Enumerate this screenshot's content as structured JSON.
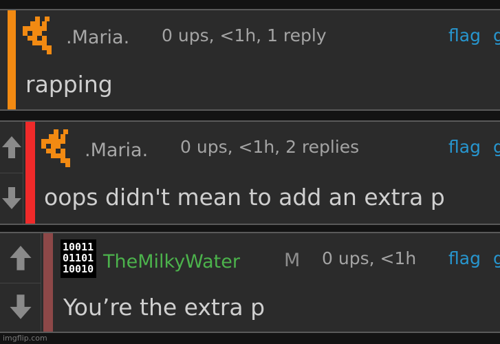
{
  "colors": {
    "stripe_orange": "#f28a12",
    "stripe_red": "#f02a2a",
    "stripe_dark_red": "#8d4848",
    "username_green": "#4cb34c",
    "flag_blue": "#2796cf",
    "avatar_orange": "#f28a12"
  },
  "icons": {
    "upvote": "arrow-up-icon",
    "downvote": "arrow-down-icon",
    "maria_avatar": "pixel-avatar-icon",
    "milky_avatar": "binary-avatar-icon"
  },
  "comments": [
    {
      "username": ".Maria.",
      "meta": "0 ups, <1h, 1 reply",
      "flag": "flag",
      "flag_suffix": "g",
      "text": "rapping"
    },
    {
      "username": ".Maria.",
      "meta": "0 ups, <1h, 2 replies",
      "flag": "flag",
      "flag_suffix": "g",
      "text": "oops didn't mean to add an extra p"
    },
    {
      "username": "TheMilkyWater",
      "mod_badge": "M",
      "meta": "0 ups, <1h",
      "flag": "flag",
      "flag_suffix": "g",
      "text": "You’re the extra p",
      "avatar_rows": [
        "10011",
        "01101",
        "10010"
      ]
    }
  ],
  "watermark": "imgflip.com"
}
